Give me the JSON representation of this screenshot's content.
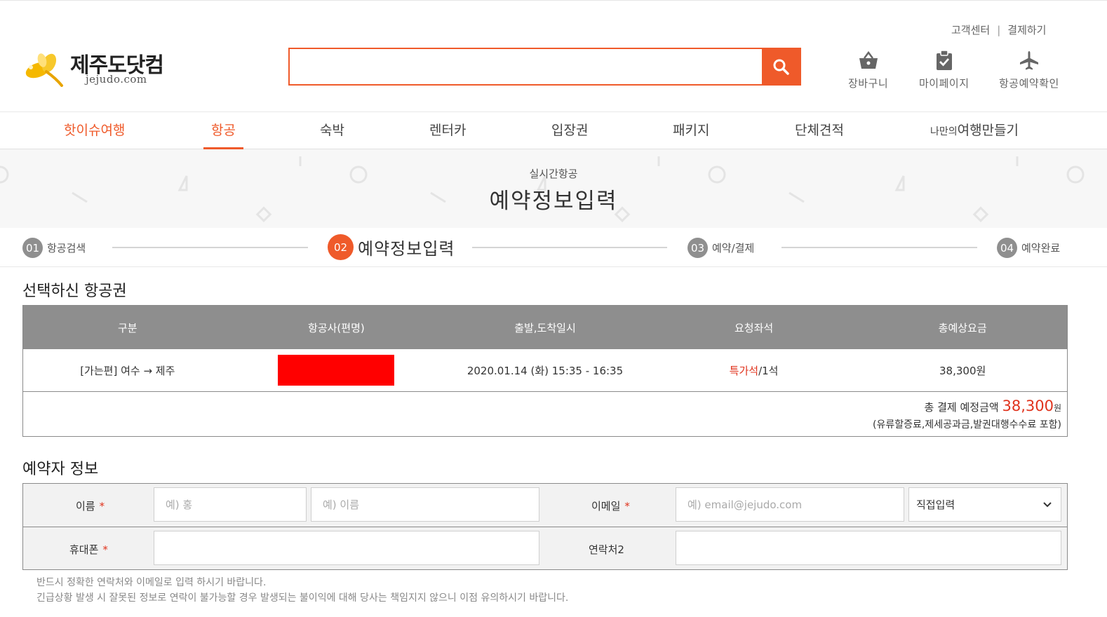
{
  "util": {
    "customer_center": "고객센터",
    "separator": "|",
    "checkout": "결제하기"
  },
  "logo": {
    "korean": "제주도닷컴",
    "english": "jejudo.com"
  },
  "search": {
    "placeholder": ""
  },
  "quick_links": [
    {
      "label": "장바구니",
      "icon": "basket-icon"
    },
    {
      "label": "마이페이지",
      "icon": "clipboard-check-icon"
    },
    {
      "label": "항공예약확인",
      "icon": "airplane-icon"
    }
  ],
  "gnb": {
    "hot_issue": "핫이슈여행",
    "air": "항공",
    "stay": "숙박",
    "rentcar": "렌터카",
    "ticket": "입장권",
    "package": "패키지",
    "group": "단체견적",
    "custom_prefix": "나만의",
    "custom_main": "여행만들기"
  },
  "banner": {
    "subtitle": "실시간항공",
    "title": "예약정보입력"
  },
  "steps": [
    {
      "num": "01",
      "label": "항공검색"
    },
    {
      "num": "02",
      "label": "예약정보입력"
    },
    {
      "num": "03",
      "label": "예약/결제"
    },
    {
      "num": "04",
      "label": "예약완료"
    }
  ],
  "selected_ticket": {
    "title": "선택하신 항공권",
    "headers": [
      "구분",
      "항공사(편명)",
      "출발,도착일시",
      "요청좌석",
      "총예상요금"
    ],
    "row": {
      "segment": "[가는편] 여수 → 제주",
      "datetime": "2020.01.14 (화) 15:35 - 16:35",
      "seat_type": "특가석",
      "seat_count": "/1석",
      "fare": "38,300원"
    },
    "total_label": "총 결제 예정금액",
    "total_amount": "38,300",
    "total_unit": "원",
    "total_note": "(유류할증료,제세공과금,발권대행수수료 포함)"
  },
  "reserver": {
    "title": "예약자 정보",
    "name_label": "이름",
    "required_mark": "*",
    "last_name_placeholder": "예) 홍",
    "first_name_placeholder": "예) 이름",
    "email_label": "이메일",
    "email_placeholder": "예) email@jejudo.com",
    "email_domain_selected": "직접입력",
    "phone_label": "휴대폰",
    "contact2_label": "연락처2"
  },
  "notice": {
    "line1": "반드시 정확한 연락처와 이메일로 입력 하시기 바랍니다.",
    "line2": "긴급상황 발생 시 잘못된 정보로 연락이 불가능할 경우 발생되는 불이익에 대해 당사는 책임지지 않으니 이점 유의하시기 바랍니다."
  },
  "colors": {
    "accent": "#ef5a2a",
    "price_red": "#e0331d",
    "table_head": "#8e8e8e"
  }
}
